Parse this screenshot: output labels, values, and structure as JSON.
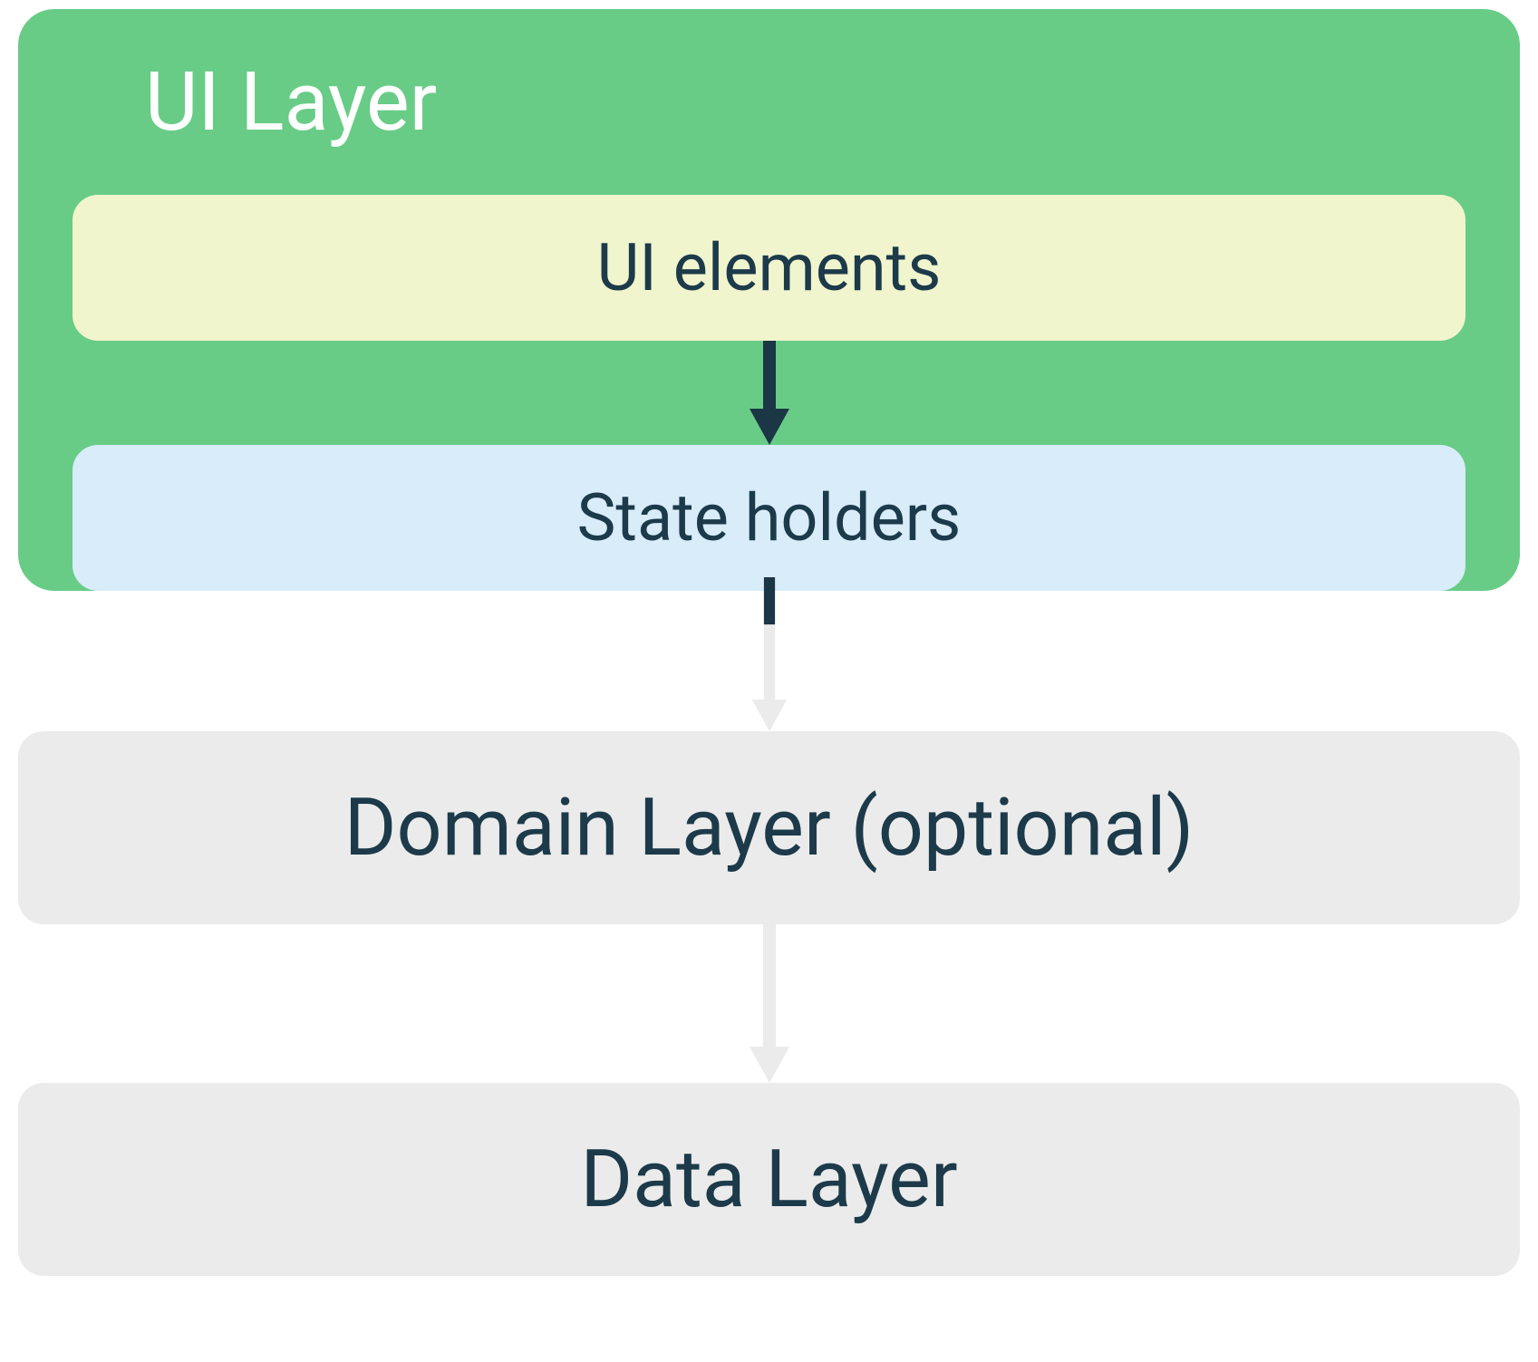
{
  "ui_layer": {
    "title": "UI Layer",
    "ui_elements_label": "UI elements",
    "state_holders_label": "State holders"
  },
  "domain_layer": {
    "label": "Domain Layer (optional)"
  },
  "data_layer": {
    "label": "Data Layer"
  },
  "colors": {
    "ui_layer_bg": "#68cc87",
    "ui_elements_bg": "#f1f5cd",
    "state_holders_bg": "#d8ecf9",
    "layer_bg": "#ebebeb",
    "text_dark": "#1c3a4a",
    "arrow_dark": "#1b3644",
    "arrow_light": "#ebebeb"
  }
}
